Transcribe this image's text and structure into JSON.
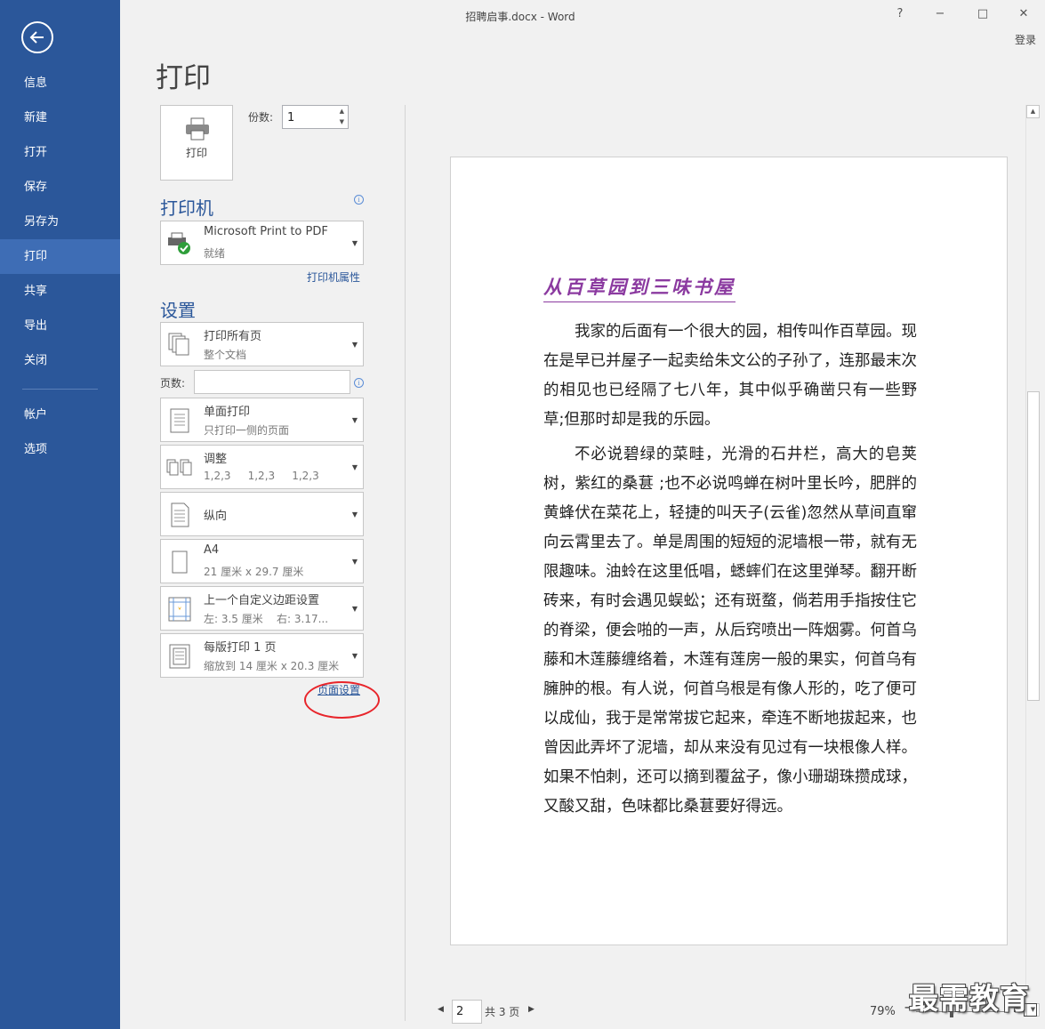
{
  "window": {
    "title": "招聘启事.docx - Word",
    "help": "?",
    "minimize": "−",
    "maximize": "□",
    "close": "✕",
    "login": "登录"
  },
  "nav": {
    "items": [
      {
        "label": "信息"
      },
      {
        "label": "新建"
      },
      {
        "label": "打开"
      },
      {
        "label": "保存"
      },
      {
        "label": "另存为"
      },
      {
        "label": "打印",
        "active": true
      },
      {
        "label": "共享"
      },
      {
        "label": "导出"
      },
      {
        "label": "关闭"
      },
      {
        "label": "帐户"
      },
      {
        "label": "选项"
      }
    ]
  },
  "heading": "打印",
  "print": {
    "button_label": "打印",
    "copies_label": "份数:",
    "copies_value": "1"
  },
  "printer": {
    "section_title": "打印机",
    "name": "Microsoft Print to PDF",
    "status": "就绪",
    "properties_link": "打印机属性"
  },
  "settings": {
    "section_title": "设置",
    "range": {
      "title": "打印所有页",
      "subtitle": "整个文档"
    },
    "pages_label": "页数:",
    "pages_value": "",
    "sides": {
      "title": "单面打印",
      "subtitle": "只打印一侧的页面"
    },
    "collate": {
      "title": "调整",
      "subtitle": "1,2,3     1,2,3     1,2,3"
    },
    "orientation": {
      "title": "纵向"
    },
    "paper": {
      "title": "A4",
      "subtitle": "21 厘米 x 29.7 厘米"
    },
    "margins": {
      "title": "上一个自定义边距设置",
      "subtitle": "左: 3.5 厘米    右: 3.17..."
    },
    "per_sheet": {
      "title": "每版打印 1 页",
      "subtitle": "缩放到 14 厘米 x 20.3 厘米"
    },
    "page_setup_link": "页面设置"
  },
  "document": {
    "title": "从百草园到三味书屋",
    "paragraphs": [
      "我家的后面有一个很大的园，相传叫作百草园。现在是早已并屋子一起卖给朱文公的子孙了，连那最末次的相见也已经隔了七八年，其中似乎确凿只有一些野草;但那时却是我的乐园。",
      "不必说碧绿的菜畦，光滑的石井栏，高大的皂荚树，紫红的桑葚 ;也不必说鸣蝉在树叶里长吟，肥胖的黄蜂伏在菜花上，轻捷的叫天子(云雀)忽然从草间直窜向云霄里去了。单是周围的短短的泥墙根一带，就有无限趣味。油蛉在这里低唱，蟋蟀们在这里弹琴。翻开断砖来，有时会遇见蜈蚣；还有斑蝥，倘若用手指按住它的脊梁，便会啪的一声，从后窍喷出一阵烟雾。何首乌藤和木莲藤缠络着，木莲有莲房一般的果实，何首乌有臃肿的根。有人说，何首乌根是有像人形的，吃了便可以成仙，我于是常常拔它起来，牵连不断地拔起来，也曾因此弄坏了泥墙，却从来没有见过有一块根像人样。如果不怕刺，还可以摘到覆盆子，像小珊瑚珠攒成球，又酸又甜，色味都比桑葚要好得远。"
    ]
  },
  "footer": {
    "current_page": "2",
    "total_pages": "共 3 页",
    "zoom": "79%",
    "zoom_minus": "−",
    "zoom_plus": "+"
  },
  "watermark": "最需教育",
  "colors": {
    "nav_bg": "#2b579a",
    "accent": "#2b579a",
    "title_purple": "#8b3aa0",
    "annotation_red": "#e8252b"
  }
}
